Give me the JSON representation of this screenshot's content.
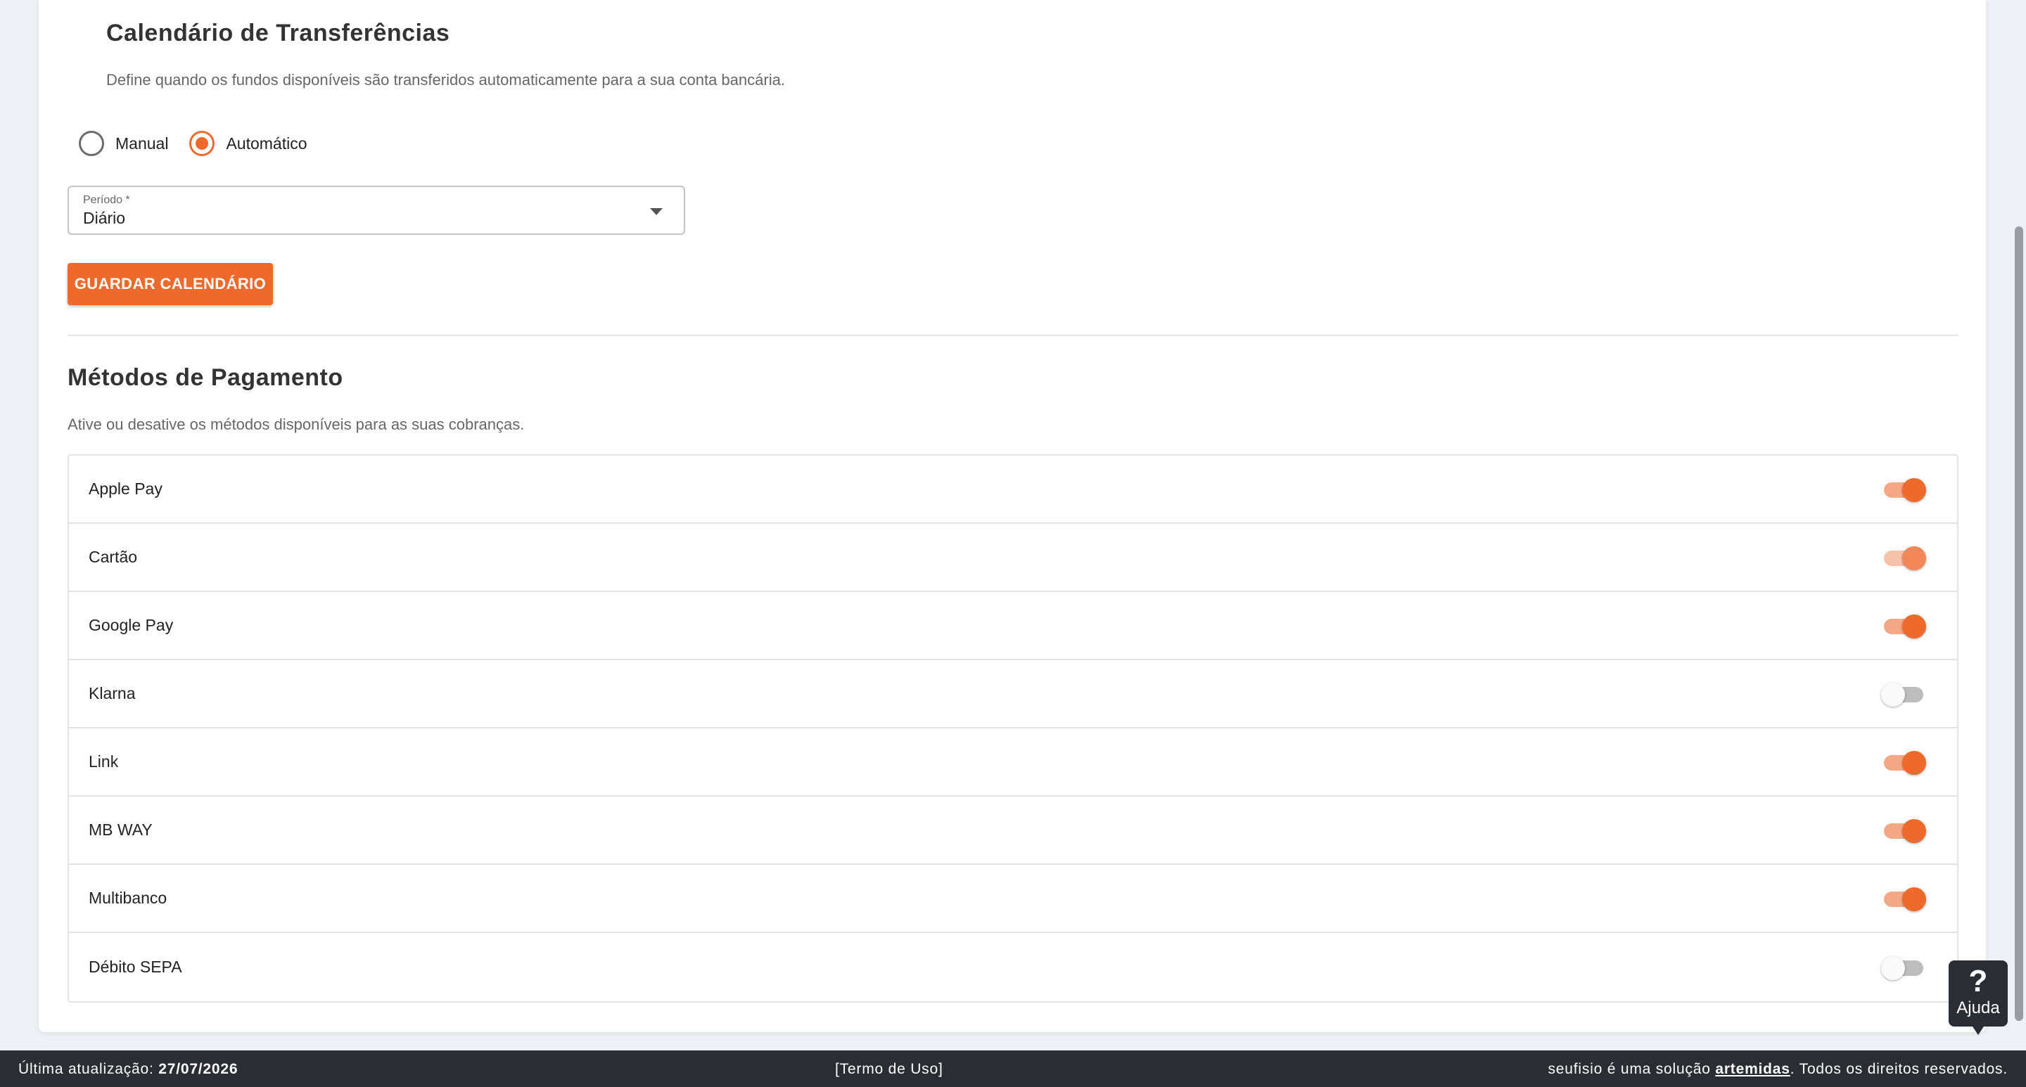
{
  "transfers": {
    "title": "Calendário de Transferências",
    "description": "Define quando os fundos disponíveis são transferidos automaticamente para a sua conta bancária.",
    "options": [
      {
        "label": "Manual",
        "checked": false
      },
      {
        "label": "Automático",
        "checked": true
      }
    ],
    "period": {
      "label": "Período *",
      "value": "Diário"
    },
    "save_label": "GUARDAR CALENDÁRIO"
  },
  "payments": {
    "title": "Métodos de Pagamento",
    "description": "Ative ou desative os métodos disponíveis para as suas cobranças.",
    "methods": [
      {
        "name": "Apple Pay",
        "enabled": true,
        "dim": false
      },
      {
        "name": "Cartão",
        "enabled": true,
        "dim": true
      },
      {
        "name": "Google Pay",
        "enabled": true,
        "dim": false
      },
      {
        "name": "Klarna",
        "enabled": false,
        "dim": false
      },
      {
        "name": "Link",
        "enabled": true,
        "dim": false
      },
      {
        "name": "MB WAY",
        "enabled": true,
        "dim": false
      },
      {
        "name": "Multibanco",
        "enabled": true,
        "dim": false
      },
      {
        "name": "Débito SEPA",
        "enabled": false,
        "dim": false
      }
    ]
  },
  "help": {
    "glyph": "?",
    "label": "Ajuda"
  },
  "footer": {
    "updated_label": "Última atualização:",
    "updated_date": "27/07/2026",
    "terms": "[Termo de Uso]",
    "brand_text": "seufisio é uma solução",
    "brand_link": "artemidas",
    "rights": ". Todos os direitos reservados."
  },
  "colors": {
    "accent": "#ee6a2c",
    "footer_bg": "#2a2d33",
    "page_bg": "#eef0f5"
  }
}
